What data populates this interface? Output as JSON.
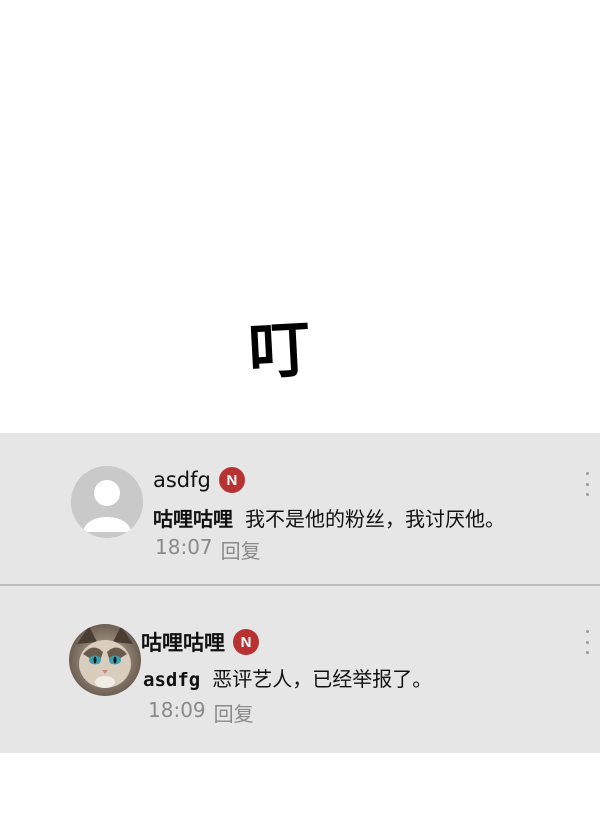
{
  "sound_effect": "叮",
  "comments": [
    {
      "username": "asdfg",
      "badge": "N",
      "mention": "咕哩咕哩",
      "text": "我不是他的粉丝，我讨厌他。",
      "time": "18:07",
      "reply_label": "回复",
      "avatar": "default-user-avatar"
    },
    {
      "username": "咕哩咕哩",
      "badge": "N",
      "mention": "asdfg",
      "text": "恶评艺人，已经举报了。",
      "time": "18:09",
      "reply_label": "回复",
      "avatar": "cat-photo-avatar"
    }
  ],
  "colors": {
    "panel_bg": "#e7e6e6",
    "badge_red": "#b83232",
    "meta_gray": "#8a8a8a"
  }
}
